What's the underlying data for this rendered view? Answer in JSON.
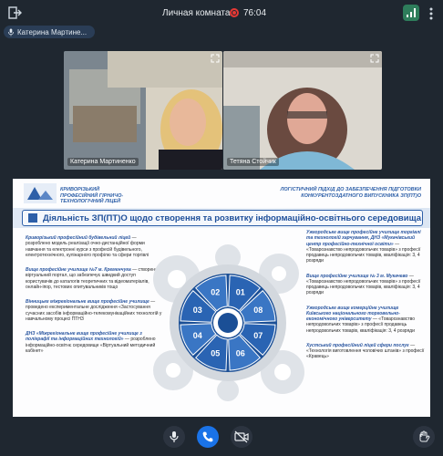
{
  "header": {
    "room_title": "Личная комната",
    "timer": "76:04"
  },
  "user_chip": {
    "label": "Катерина Мартине..."
  },
  "participants": [
    {
      "name": "Катерина Мартиненко"
    },
    {
      "name": "Тетяна Стойчик"
    }
  ],
  "slide": {
    "org_name": "КРИВОРІЗЬКИЙ ПРОФЕСІЙНИЙ ГІРНИЧО-ТЕХНОЛОГІЧНИЙ ЛІЦЕЙ",
    "subtitle": "ЛОГІСТИЧНИЙ ПІДХІД ДО ЗАБЕЗПЕЧЕННЯ ПІДГОТОВКИ КОНКУРЕНТОЗДАТНОГО ВИПУСКНИКА ЗП(ПТ)О",
    "title": "Діяльність ЗП(ПТ)О щодо створення та розвитку інформаційно-освітнього середовища",
    "left_items": [
      {
        "org": "Криворізький професійний будівельний ліцей",
        "text": " — розроблено модель реалізації очно-дистанційної форми навчання та електронні курси з професій будівельного, електротехнічного, кулінарного профілю та сфери торгівлі"
      },
      {
        "org": "Вище професійне училище №7 м. Кременчука",
        "text": " — створено віртуальний портал, що забезпечує швидкий доступ користувачів до каталогів теоретичних та відеоматеріалів, онлайн-іпор, тестових опитувальників тощо"
      },
      {
        "org": "Вінницьке міжрегіональне вище професійне училище",
        "text": " — проведено експериментальне дослідження «Застосування сучасних засобів інформаційно-телекомунікаційних технологій у навчальному процесі ПТНЗ"
      },
      {
        "org": "ДНЗ «Міжрегіональне вище професійне училище з поліграфії та інформаційних технологій»",
        "text": " — розроблено інформаційно-освітнє середовище «Віртуальний методичний кабінет»"
      }
    ],
    "right_items": [
      {
        "org": "Ужгородське вище професійне училище торгівлі та технологій харчування, ДНЗ «Мукачівський центр професійно-технічної освіти»",
        "text": " — «Товарознавство непродовольчих товарів» з професії продавець непродовольчих товарів, кваліфікація: 3, 4 розряди"
      },
      {
        "org": "Вище професійне училище № 3 м. Мукачево",
        "text": " — «Товарознавство непродовольчих товарів» з професії продавець непродовольчих товарів, кваліфікація: 3, 4 розряди"
      },
      {
        "org": "Ужгородське вище комерційне училище Київського національного торговельно-економічного університету",
        "text": " — «Товарознавство непродовольчих товарів» з професії продавець непродовольчих товарів, кваліфікація: 3, 4 розряди"
      },
      {
        "org": "Хустський професійний ліцей сфери послуг",
        "text": " — «Технологія виготовлення чоловічих штанів» з професії «Кравець»"
      }
    ],
    "wheel_numbers": [
      "01",
      "02",
      "03",
      "04",
      "05",
      "06",
      "07",
      "08"
    ]
  },
  "colors": {
    "accent": "#1a73e8",
    "slide_blue": "#2d5fa8",
    "record": "#e53935"
  }
}
